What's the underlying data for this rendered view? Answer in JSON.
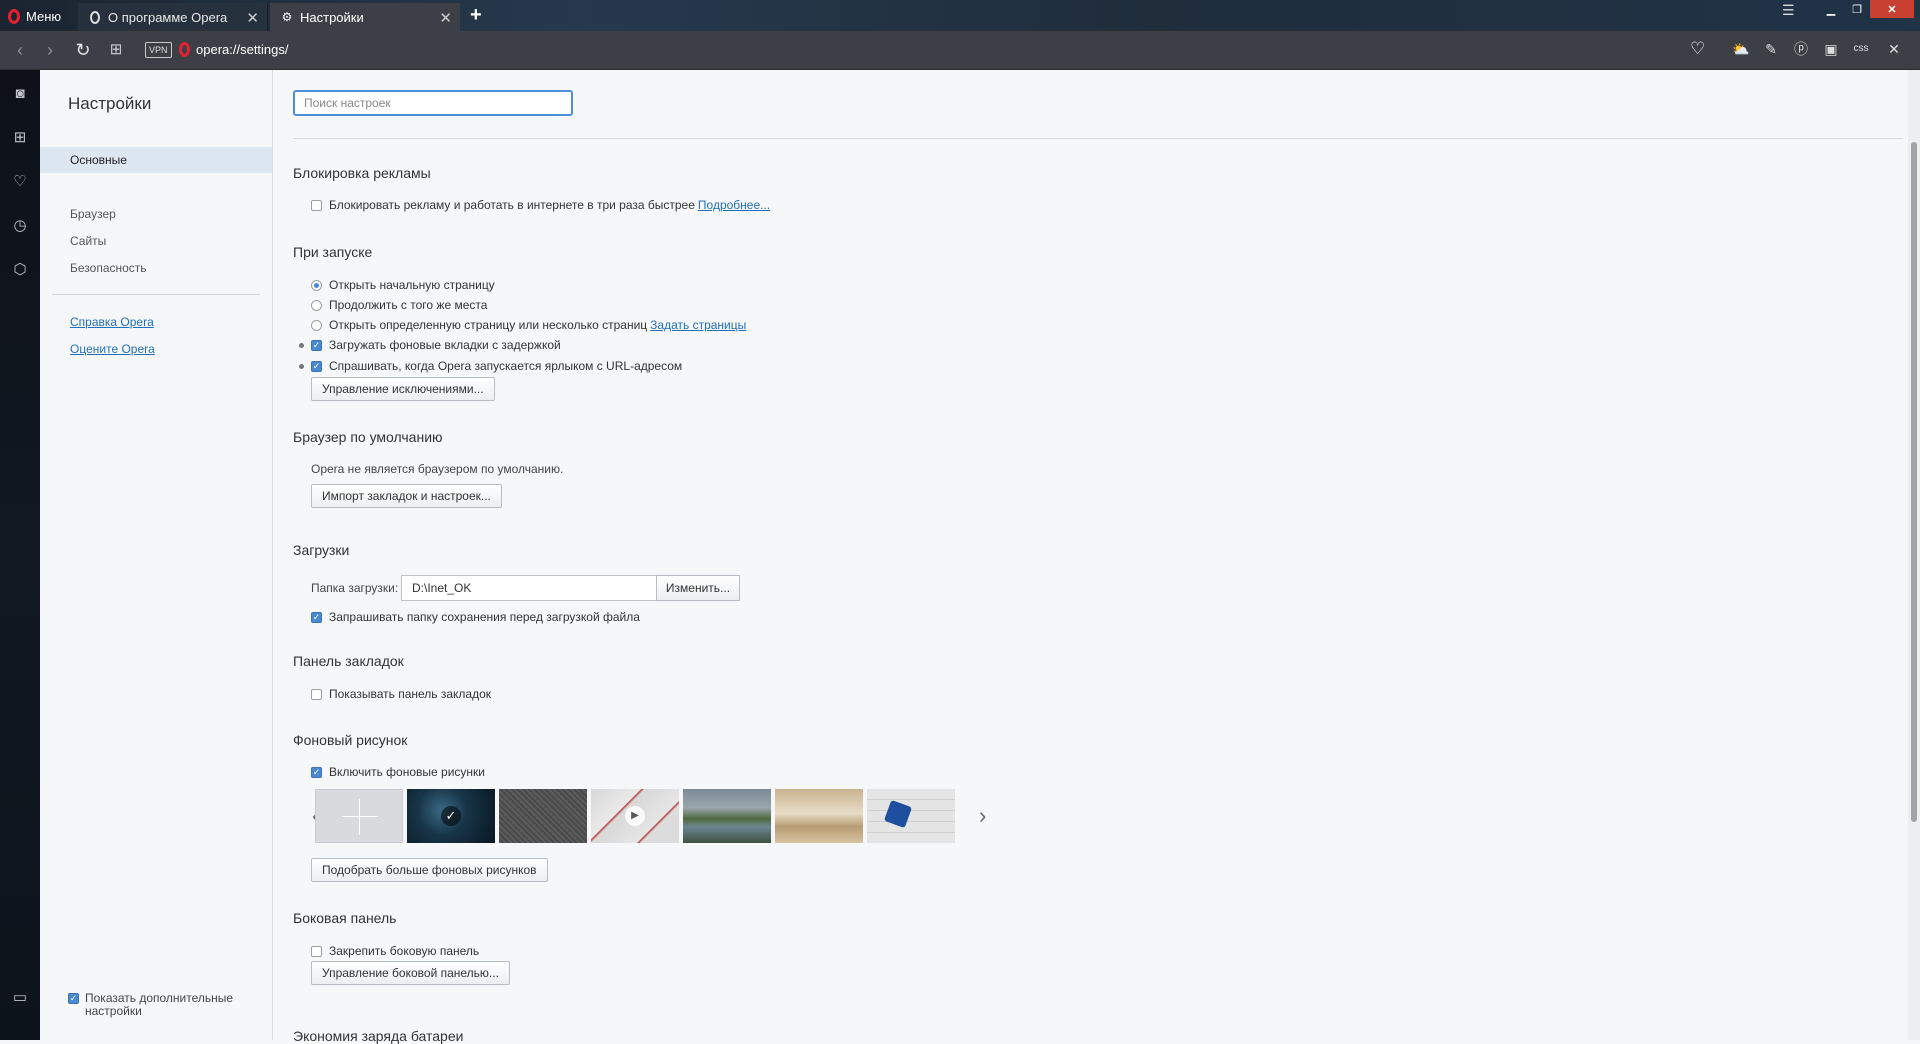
{
  "tabbar": {
    "menu_label": "Меню",
    "tabs": [
      {
        "label": "О программе Opera",
        "state": "inactive"
      },
      {
        "label": "Настройки",
        "state": "active"
      }
    ],
    "new_tab_icon": "plus-icon",
    "window_controls": [
      "minimize",
      "maximize",
      "close"
    ]
  },
  "addressbar": {
    "vpn_label": "VPN",
    "url": "opera://settings/",
    "extensions_label_css": "css"
  },
  "settings_nav": {
    "title": "Настройки",
    "items": [
      {
        "label": "Основные",
        "active": true
      },
      {
        "label": "Браузер",
        "active": false
      },
      {
        "label": "Сайты",
        "active": false
      },
      {
        "label": "Безопасность",
        "active": false
      }
    ],
    "links": [
      "Справка Opera",
      "Оцените Opera"
    ],
    "advanced": {
      "label": "Показать дополнительные настройки",
      "checked": true
    }
  },
  "main": {
    "search_placeholder": "Поиск настроек",
    "adblock": {
      "title": "Блокировка рекламы",
      "checkbox_label": "Блокировать рекламу и работать в интернете в три раза быстрее",
      "link": "Подробнее...",
      "checked": false
    },
    "startup": {
      "title": "При запуске",
      "options": [
        {
          "label": "Открыть начальную страницу",
          "checked": true
        },
        {
          "label": "Продолжить с того же места",
          "checked": false
        },
        {
          "label": "Открыть определенную страницу или несколько страниц",
          "checked": false
        }
      ],
      "set_pages_link": "Задать страницы",
      "checks": [
        {
          "label": "Загружать фоновые вкладки с задержкой",
          "checked": true
        },
        {
          "label": "Спрашивать, когда Opera запускается ярлыком с URL-адресом",
          "checked": true
        }
      ],
      "exceptions_button": "Управление исключениями..."
    },
    "default_browser": {
      "title": "Браузер по умолчанию",
      "status": "Opera не является браузером по умолчанию.",
      "import_button": "Импорт закладок и настроек..."
    },
    "downloads": {
      "title": "Загрузки",
      "folder_label": "Папка загрузки:",
      "folder_value": "D:\\Inet_OK",
      "change_button": "Изменить...",
      "ask_label": "Запрашивать папку сохранения перед загрузкой файла",
      "ask_checked": true
    },
    "bookmarks_bar": {
      "title": "Панель закладок",
      "show_label": "Показывать панель закладок",
      "checked": false
    },
    "wallpaper": {
      "title": "Фоновый рисунок",
      "enable_label": "Включить фоновые рисунки",
      "enabled": true,
      "thumbnails": [
        "add",
        "dark-network-selected",
        "gray-texture",
        "video-red-lines",
        "lake-landscape",
        "interior-room",
        "puzzle"
      ],
      "more_button": "Подобрать больше фоновых рисунков"
    },
    "side_panel": {
      "title": "Боковая панель",
      "pin_label": "Закрепить боковую панель",
      "pin_checked": false,
      "manage_button": "Управление боковой панелью..."
    },
    "battery": {
      "title": "Экономия заряда батареи"
    }
  },
  "colors": {
    "accent": "#4a88d0",
    "link": "#2470b8",
    "opera_red": "#e4222f"
  }
}
